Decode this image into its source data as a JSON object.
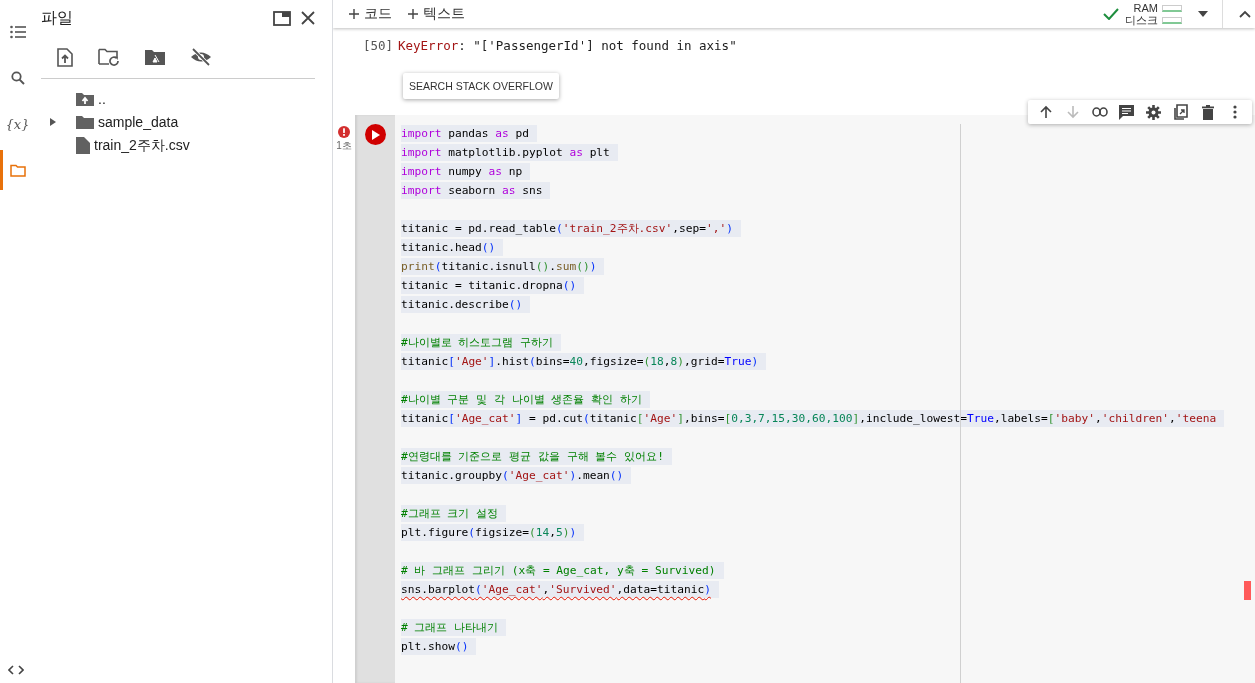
{
  "rail": [
    {
      "kind": "contents",
      "selected": false
    },
    {
      "kind": "search",
      "selected": false
    },
    {
      "kind": "variables",
      "label": "{x}",
      "selected": false
    },
    {
      "kind": "files",
      "selected": true
    }
  ],
  "file_panel": {
    "title": "파일",
    "tree": [
      {
        "kind": "parent",
        "name": ".."
      },
      {
        "kind": "folder",
        "name": "sample_data",
        "expanded": false
      },
      {
        "kind": "file",
        "name": "train_2주차.csv"
      }
    ]
  },
  "toolbar": {
    "buttons": [
      {
        "label": "코드"
      },
      {
        "label": "텍스트"
      }
    ],
    "resources": {
      "connected": true,
      "labels": [
        "RAM",
        "디스크"
      ]
    }
  },
  "output": {
    "exec_count": "[50]",
    "error_name": "KeyError",
    "error_message": ": \"['PassengerId'] not found in axis\"",
    "button": "SEARCH STACK OVERFLOW"
  },
  "cell": {
    "error": true,
    "elapsed": "1초",
    "tools": [
      {
        "kind": "up",
        "disabled": false
      },
      {
        "kind": "down",
        "disabled": true
      },
      {
        "kind": "link",
        "disabled": false
      },
      {
        "kind": "comment",
        "disabled": false
      },
      {
        "kind": "settings",
        "disabled": false
      },
      {
        "kind": "mirror",
        "disabled": false
      },
      {
        "kind": "delete",
        "disabled": false
      },
      {
        "kind": "more",
        "disabled": false
      }
    ],
    "lines": [
      {
        "kind": "code",
        "error": false,
        "tokens": [
          {
            "kind": "kw",
            "text": "import"
          },
          {
            "kind": "p",
            "text": " pandas "
          },
          {
            "kind": "kw",
            "text": "as"
          },
          {
            "kind": "p",
            "text": " pd"
          }
        ]
      },
      {
        "kind": "code",
        "error": false,
        "tokens": [
          {
            "kind": "kw",
            "text": "import"
          },
          {
            "kind": "p",
            "text": " matplotlib.pyplot "
          },
          {
            "kind": "kw",
            "text": "as"
          },
          {
            "kind": "p",
            "text": " plt"
          }
        ]
      },
      {
        "kind": "code",
        "error": false,
        "tokens": [
          {
            "kind": "kw",
            "text": "import"
          },
          {
            "kind": "p",
            "text": " numpy "
          },
          {
            "kind": "kw",
            "text": "as"
          },
          {
            "kind": "p",
            "text": " np"
          }
        ]
      },
      {
        "kind": "code",
        "error": false,
        "tokens": [
          {
            "kind": "kw",
            "text": "import"
          },
          {
            "kind": "p",
            "text": " seaborn "
          },
          {
            "kind": "kw",
            "text": "as"
          },
          {
            "kind": "p",
            "text": " sns"
          }
        ]
      },
      {
        "kind": "blank"
      },
      {
        "kind": "code",
        "error": false,
        "tokens": [
          {
            "kind": "p",
            "text": "titanic = pd.read_table"
          },
          {
            "kind": "b1",
            "text": "("
          },
          {
            "kind": "s",
            "text": "'train_2주차.csv'"
          },
          {
            "kind": "p",
            "text": ",sep="
          },
          {
            "kind": "s",
            "text": "','"
          },
          {
            "kind": "b1",
            "text": ")"
          }
        ]
      },
      {
        "kind": "code",
        "error": false,
        "tokens": [
          {
            "kind": "p",
            "text": "titanic.head"
          },
          {
            "kind": "b1",
            "text": "()"
          }
        ]
      },
      {
        "kind": "code",
        "error": false,
        "tokens": [
          {
            "kind": "f",
            "text": "print"
          },
          {
            "kind": "b1",
            "text": "("
          },
          {
            "kind": "p",
            "text": "titanic.isnull"
          },
          {
            "kind": "b2",
            "text": "()"
          },
          {
            "kind": "p",
            "text": "."
          },
          {
            "kind": "f",
            "text": "sum"
          },
          {
            "kind": "b2",
            "text": "()"
          },
          {
            "kind": "b1",
            "text": ")"
          }
        ]
      },
      {
        "kind": "code",
        "error": false,
        "tokens": [
          {
            "kind": "p",
            "text": "titanic = titanic.dropna"
          },
          {
            "kind": "b1",
            "text": "()"
          }
        ]
      },
      {
        "kind": "code",
        "error": false,
        "tokens": [
          {
            "kind": "p",
            "text": "titanic.describe"
          },
          {
            "kind": "b1",
            "text": "()"
          }
        ]
      },
      {
        "kind": "blank"
      },
      {
        "kind": "code",
        "error": false,
        "tokens": [
          {
            "kind": "c",
            "text": "#나이별로 히스토그램 구하기"
          }
        ]
      },
      {
        "kind": "code",
        "error": false,
        "tokens": [
          {
            "kind": "p",
            "text": "titanic"
          },
          {
            "kind": "b1",
            "text": "["
          },
          {
            "kind": "s",
            "text": "'Age'"
          },
          {
            "kind": "b1",
            "text": "]"
          },
          {
            "kind": "p",
            "text": ".hist"
          },
          {
            "kind": "b1",
            "text": "("
          },
          {
            "kind": "p",
            "text": "bins="
          },
          {
            "kind": "n",
            "text": "40"
          },
          {
            "kind": "p",
            "text": ",figsize="
          },
          {
            "kind": "b2",
            "text": "("
          },
          {
            "kind": "n",
            "text": "18"
          },
          {
            "kind": "p",
            "text": ","
          },
          {
            "kind": "n",
            "text": "8"
          },
          {
            "kind": "b2",
            "text": ")"
          },
          {
            "kind": "p",
            "text": ",grid="
          },
          {
            "kind": "bool",
            "text": "True"
          },
          {
            "kind": "b1",
            "text": ")"
          }
        ]
      },
      {
        "kind": "blank"
      },
      {
        "kind": "code",
        "error": false,
        "tokens": [
          {
            "kind": "c",
            "text": "#나이별 구분 및 각 나이별 생존율 확인 하기"
          }
        ]
      },
      {
        "kind": "code",
        "error": false,
        "tokens": [
          {
            "kind": "p",
            "text": "titanic"
          },
          {
            "kind": "b1",
            "text": "["
          },
          {
            "kind": "s",
            "text": "'Age_cat'"
          },
          {
            "kind": "b1",
            "text": "]"
          },
          {
            "kind": "p",
            "text": " = pd.cut"
          },
          {
            "kind": "b1",
            "text": "("
          },
          {
            "kind": "p",
            "text": "titanic"
          },
          {
            "kind": "b2",
            "text": "["
          },
          {
            "kind": "s",
            "text": "'Age'"
          },
          {
            "kind": "b2",
            "text": "]"
          },
          {
            "kind": "p",
            "text": ",bins="
          },
          {
            "kind": "b2",
            "text": "["
          },
          {
            "kind": "n",
            "text": "0,3,7,15,30,60,100"
          },
          {
            "kind": "b2",
            "text": "]"
          },
          {
            "kind": "p",
            "text": ",include_lowest="
          },
          {
            "kind": "bool",
            "text": "True"
          },
          {
            "kind": "p",
            "text": ",labels="
          },
          {
            "kind": "b2",
            "text": "["
          },
          {
            "kind": "s",
            "text": "'baby'"
          },
          {
            "kind": "p",
            "text": ","
          },
          {
            "kind": "s",
            "text": "'children'"
          },
          {
            "kind": "p",
            "text": ","
          },
          {
            "kind": "s",
            "text": "'teena"
          }
        ]
      },
      {
        "kind": "blank"
      },
      {
        "kind": "code",
        "error": false,
        "tokens": [
          {
            "kind": "c",
            "text": "#연령대를 기준으로 평균 값을 구해 볼수 있어요!"
          }
        ]
      },
      {
        "kind": "code",
        "error": false,
        "tokens": [
          {
            "kind": "p",
            "text": "titanic.groupby"
          },
          {
            "kind": "b1",
            "text": "("
          },
          {
            "kind": "s",
            "text": "'Age_cat'"
          },
          {
            "kind": "b1",
            "text": ")"
          },
          {
            "kind": "p",
            "text": ".mean"
          },
          {
            "kind": "b1",
            "text": "()"
          }
        ]
      },
      {
        "kind": "blank"
      },
      {
        "kind": "code",
        "error": false,
        "tokens": [
          {
            "kind": "c",
            "text": "#그래프 크기 설정"
          }
        ]
      },
      {
        "kind": "code",
        "error": false,
        "tokens": [
          {
            "kind": "p",
            "text": "plt.figure"
          },
          {
            "kind": "b1",
            "text": "("
          },
          {
            "kind": "p",
            "text": "figsize="
          },
          {
            "kind": "b2",
            "text": "("
          },
          {
            "kind": "n",
            "text": "14"
          },
          {
            "kind": "p",
            "text": ","
          },
          {
            "kind": "n",
            "text": "5"
          },
          {
            "kind": "b2",
            "text": ")"
          },
          {
            "kind": "b1",
            "text": ")"
          }
        ]
      },
      {
        "kind": "blank"
      },
      {
        "kind": "code",
        "error": false,
        "tokens": [
          {
            "kind": "c",
            "text": "# 바 그래프 그리기 (x축 = Age_cat, y축 = Survived)"
          }
        ]
      },
      {
        "kind": "code",
        "error": true,
        "tokens": [
          {
            "kind": "p",
            "text": "sns.barplot"
          },
          {
            "kind": "b1",
            "text": "("
          },
          {
            "kind": "s",
            "text": "'Age_cat'"
          },
          {
            "kind": "p",
            "text": ","
          },
          {
            "kind": "s",
            "text": "'Survived'"
          },
          {
            "kind": "p",
            "text": ",data=titanic"
          },
          {
            "kind": "b1",
            "text": ")"
          }
        ]
      },
      {
        "kind": "blank"
      },
      {
        "kind": "code",
        "error": false,
        "tokens": [
          {
            "kind": "c",
            "text": "# 그래프 나타내기"
          }
        ]
      },
      {
        "kind": "code",
        "error": false,
        "tokens": [
          {
            "kind": "p",
            "text": "plt.show"
          },
          {
            "kind": "b1",
            "text": "()"
          }
        ]
      }
    ]
  }
}
